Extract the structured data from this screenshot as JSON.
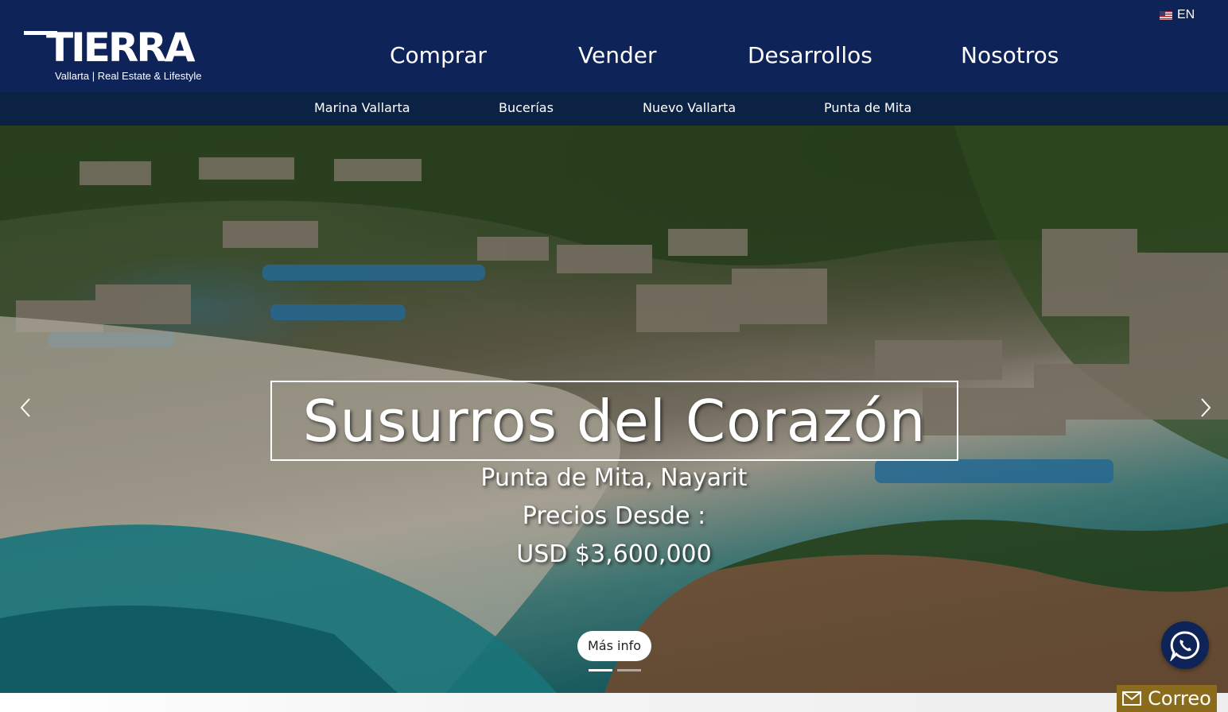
{
  "brand": {
    "name": "TIERRA",
    "tagline": "Vallarta | Real Estate & Lifestyle"
  },
  "language": {
    "flag_icon": "us-flag-icon",
    "label": "EN"
  },
  "main_nav": {
    "items": [
      {
        "label": "Comprar"
      },
      {
        "label": "Vender"
      },
      {
        "label": "Desarrollos"
      },
      {
        "label": "Nosotros"
      }
    ]
  },
  "sub_nav": {
    "items": [
      {
        "label": "Marina Vallarta"
      },
      {
        "label": "Bucerías"
      },
      {
        "label": "Nuevo Vallarta"
      },
      {
        "label": "Punta de Mita"
      }
    ]
  },
  "hero": {
    "title": "Susurros del Corazón",
    "location": "Punta de Mita, Nayarit",
    "price_label": "Precios Desde :",
    "price": "USD $3,600,000",
    "button_label": "Más info",
    "slide_count": 2,
    "active_slide": 1,
    "prev_icon": "chevron-left-icon",
    "next_icon": "chevron-right-icon"
  },
  "floating": {
    "whatsapp_icon": "whatsapp-icon",
    "mail_icon": "envelope-icon",
    "mail_label": "Correo"
  },
  "colors": {
    "header_bg": "#0e2357",
    "subnav_bg": "#0c2244",
    "mail_bg": "#8b6b1c"
  }
}
